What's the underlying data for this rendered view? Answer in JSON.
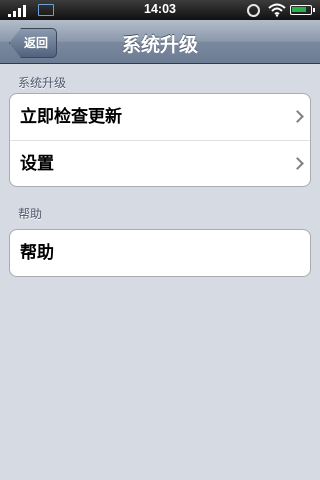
{
  "status_bar": {
    "time": "14:03",
    "battery_level": 0.85,
    "icons": [
      "signal-icon",
      "image-icon",
      "alarm-icon",
      "wifi-icon",
      "battery-icon"
    ]
  },
  "nav": {
    "back_label": "返回",
    "title": "系统升级"
  },
  "sections": [
    {
      "header": "系统升级",
      "items": [
        {
          "label": "立即检查更新",
          "has_chevron": true
        },
        {
          "label": "设置",
          "has_chevron": true
        }
      ]
    },
    {
      "header": "帮助",
      "items": [
        {
          "label": "帮助",
          "has_chevron": false
        }
      ]
    }
  ],
  "colors": {
    "background": "#d6dbe3",
    "nav_bar": "#8a98ab",
    "battery_fill": "#29b24a"
  }
}
